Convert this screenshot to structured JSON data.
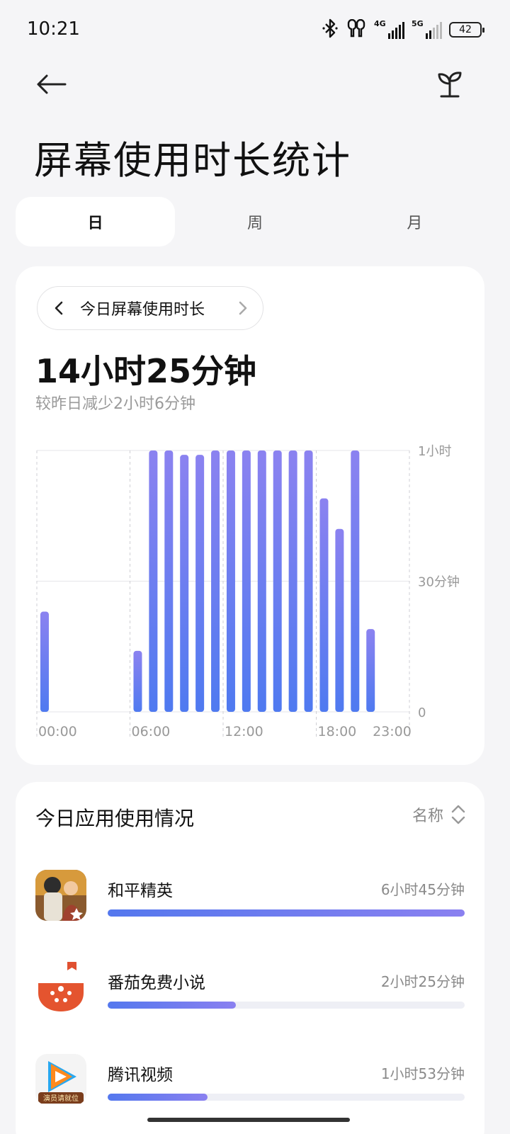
{
  "status_bar": {
    "time": "10:21",
    "network_1": "4G",
    "network_2": "5G",
    "battery": "42",
    "icons": [
      "bluetooth-icon",
      "earbuds-icon",
      "signal-4g-icon",
      "signal-5g-icon",
      "battery-icon"
    ]
  },
  "header": {
    "title": "屏幕使用时长统计",
    "back_icon": "arrow-left-icon",
    "sprout_icon": "sprout-icon"
  },
  "tabs": [
    {
      "label": "日",
      "active": true
    },
    {
      "label": "周",
      "active": false
    },
    {
      "label": "月",
      "active": false
    }
  ],
  "usage": {
    "date_label": "今日屏幕使用时长",
    "total": "14小时25分钟",
    "compare": "较昨日减少2小时6分钟"
  },
  "chart_data": {
    "type": "bar",
    "title": "",
    "xlabel": "",
    "ylabel": "",
    "x_unit": "hour of day",
    "y_unit": "minutes",
    "ylim": [
      0,
      60
    ],
    "y_ticks": [
      {
        "value": 60,
        "label": "1小时"
      },
      {
        "value": 30,
        "label": "30分钟"
      },
      {
        "value": 0,
        "label": "0"
      }
    ],
    "x_ticks": [
      "00:00",
      "06:00",
      "12:00",
      "18:00",
      "23:00"
    ],
    "grid": true,
    "categories": [
      "00",
      "01",
      "02",
      "03",
      "04",
      "05",
      "06",
      "07",
      "08",
      "09",
      "10",
      "11",
      "12",
      "13",
      "14",
      "15",
      "16",
      "17",
      "18",
      "19",
      "20",
      "21",
      "22",
      "23"
    ],
    "values": [
      23,
      0,
      0,
      0,
      0,
      0,
      14,
      60,
      60,
      59,
      59,
      60,
      60,
      60,
      60,
      60,
      60,
      60,
      49,
      42,
      60,
      19,
      0,
      0
    ],
    "bar_color_top": "#8b82f0",
    "bar_color_bottom": "#4f7af0"
  },
  "apps": {
    "title": "今日应用使用情况",
    "sort_label": "名称",
    "sort_icon": "sort-updown-icon",
    "items": [
      {
        "name": "和平精英",
        "time": "6小时45分钟",
        "ratio": 1.0,
        "icon": "peace-elite-icon"
      },
      {
        "name": "番茄免费小说",
        "time": "2小时25分钟",
        "ratio": 0.36,
        "icon": "tomato-novel-icon"
      },
      {
        "name": "腾讯视频",
        "time": "1小时53分钟",
        "ratio": 0.28,
        "icon": "tencent-video-icon"
      }
    ],
    "tencent_badge": "演员请就位"
  }
}
